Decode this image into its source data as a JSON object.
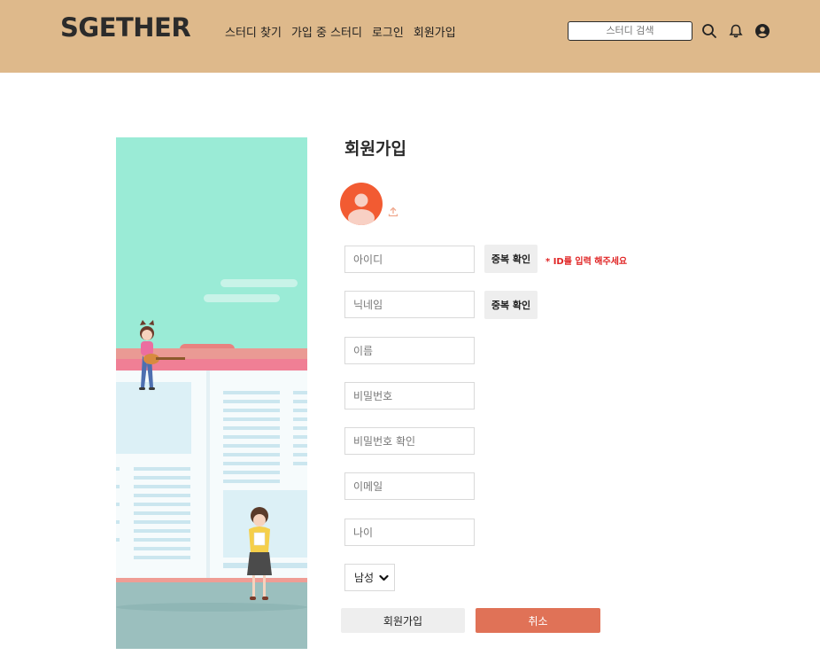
{
  "header": {
    "logo": "SGETHER",
    "nav": [
      "스터디 찾기",
      "가입 중 스터디",
      "로그인",
      "회원가입"
    ],
    "search_placeholder": "스터디 검색",
    "icons": [
      "search-icon",
      "bell-icon",
      "account-icon"
    ]
  },
  "form": {
    "title": "회원가입",
    "fields": {
      "id": "아이디",
      "nickname": "닉네임",
      "name": "이름",
      "password": "비밀번호",
      "password_confirm": "비밀번호 확인",
      "email": "이메일",
      "age": "나이"
    },
    "check_button": "중복 확인",
    "id_hint": "* ID를 입력 해주세요",
    "gender": {
      "selected": "남성"
    },
    "submit": "회원가입",
    "cancel": "취소"
  },
  "colors": {
    "header_bg": "#deb98b",
    "accent": "#e07257",
    "hint": "#e02424",
    "avatar": "#f25b32",
    "hero_sky": "#9aebd6"
  }
}
